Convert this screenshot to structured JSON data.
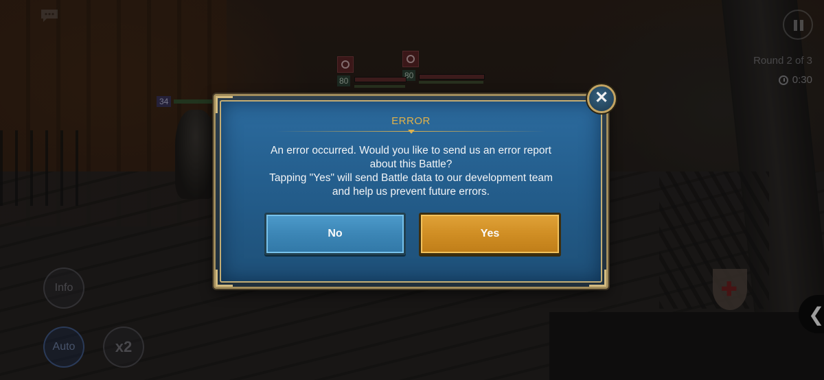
{
  "hud": {
    "round_text": "Round 2 of 3",
    "timer_text": "0:30",
    "info_label": "Info",
    "auto_label": "Auto",
    "speed_label": "x2",
    "side_tab_glyph": "❮",
    "enemy_levels": [
      "80",
      "80"
    ],
    "ally_level": "34",
    "icons": [
      "chat-icon",
      "pause-icon",
      "clock-icon",
      "enemy-emblem-icon",
      "chevron-left-icon",
      "close-icon"
    ]
  },
  "dialog": {
    "title": "ERROR",
    "message_lines": [
      "An error occurred. Would you like to send us an error report",
      "about this Battle?",
      "Tapping \"Yes\" will send Battle data to our development team",
      "and help us prevent future errors."
    ],
    "no_label": "No",
    "yes_label": "Yes",
    "close_glyph": "✕"
  },
  "colors": {
    "dialog_blue": "#245e8d",
    "gold_frame": "#c3ad74",
    "title_gold": "#e2b24a",
    "no_button": "#3c86b6",
    "yes_button": "#d08e24"
  }
}
